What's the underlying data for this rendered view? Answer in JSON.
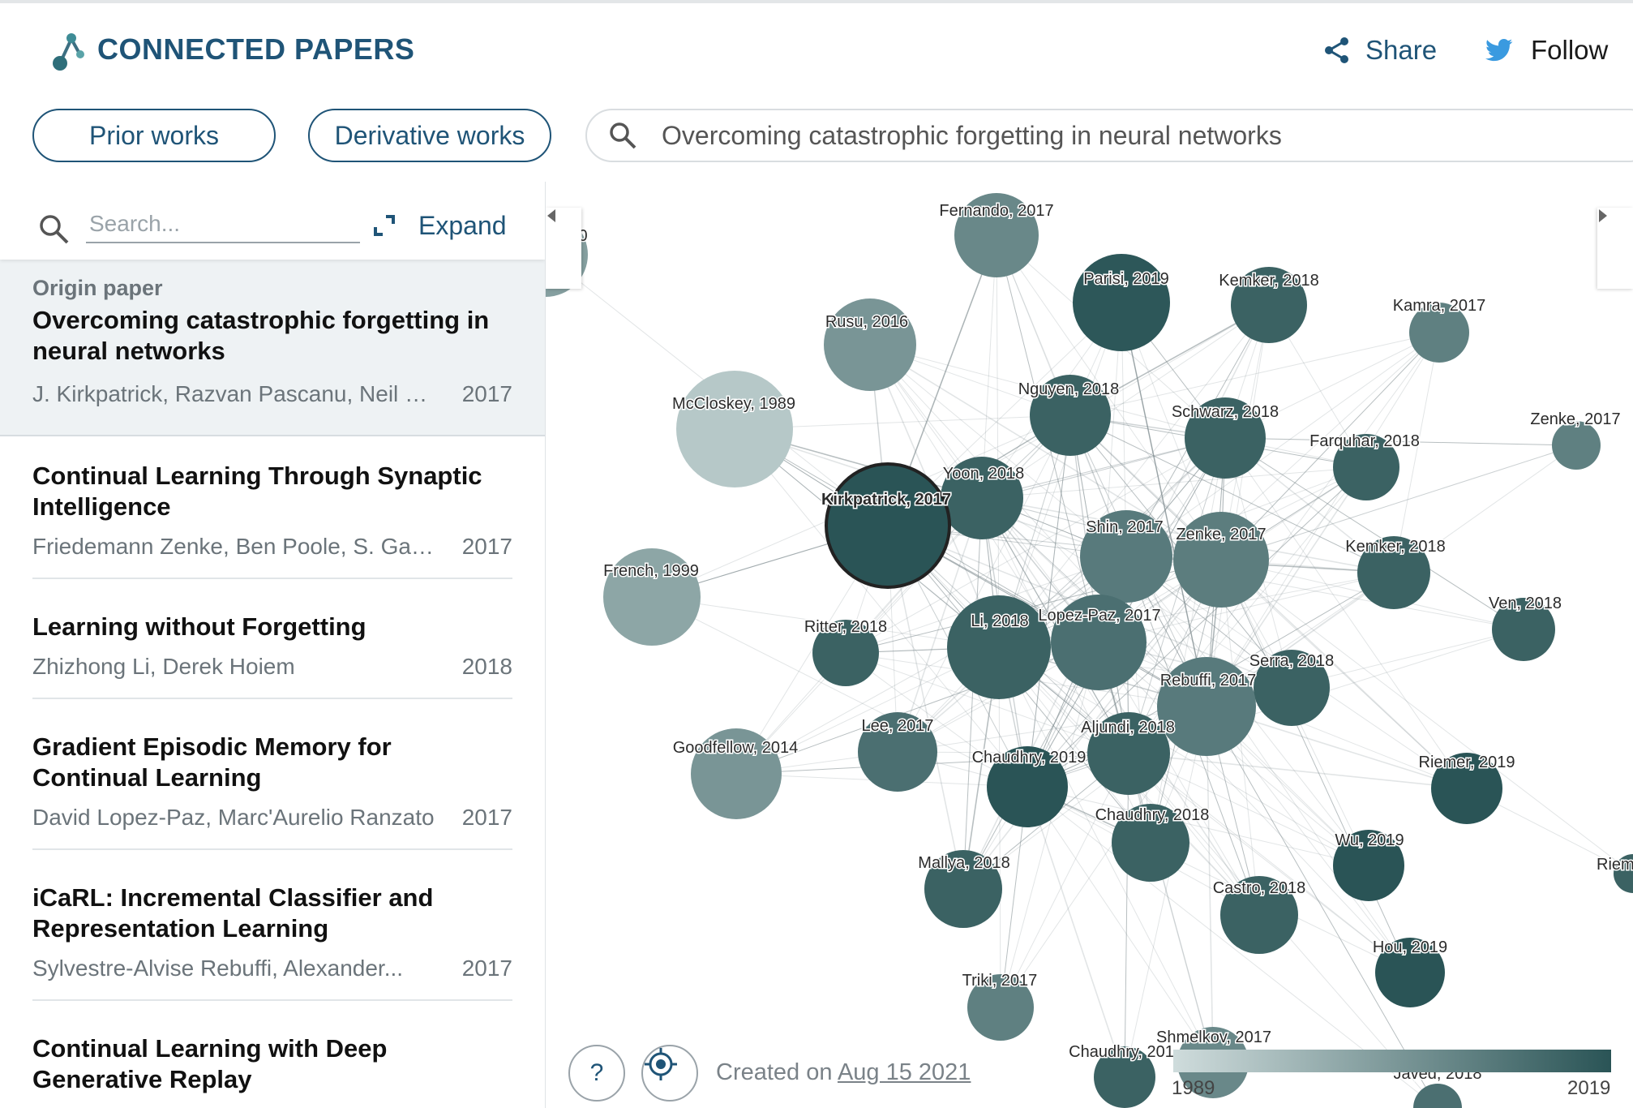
{
  "header": {
    "brand": "CONNECTED PAPERS",
    "share_label": "Share",
    "follow_label": "Follow",
    "accent": "#1f5477"
  },
  "toolbar": {
    "prior_works": "Prior works",
    "derivative_works": "Derivative works",
    "search_value": "Overcoming catastrophic forgetting in neural networks"
  },
  "sidebar": {
    "search_placeholder": "Search...",
    "expand_label": "Expand",
    "origin_label": "Origin paper",
    "origin": {
      "title": "Overcoming catastrophic forgetting in neural networks",
      "authors": "J. Kirkpatrick, Razvan Pascanu, Neil C....",
      "year": "2017"
    },
    "papers": [
      {
        "title": "Continual Learning Through Synaptic Intelligence",
        "authors": "Friedemann Zenke, Ben Poole, S. Ganguli",
        "year": "2017"
      },
      {
        "title": "Learning without Forgetting",
        "authors": "Zhizhong Li, Derek Hoiem",
        "year": "2018"
      },
      {
        "title": "Gradient Episodic Memory for Continual Learning",
        "authors": "David Lopez-Paz, Marc'Aurelio Ranzato",
        "year": "2017"
      },
      {
        "title": "iCaRL: Incremental Classifier and Representation Learning",
        "authors": "Sylvestre-Alvise Rebuffi, Alexander...",
        "year": "2017"
      },
      {
        "title": "Continual Learning with Deep Generative Replay",
        "authors": "",
        "year": ""
      }
    ]
  },
  "graph": {
    "created_prefix": "Created on ",
    "created_date": "Aug 15 2021",
    "help_label": "?",
    "legend_min": "1989",
    "legend_max": "2019",
    "color_old": "#cfdcdc",
    "color_new": "#2a5456",
    "nodes": [
      {
        "label": "Fernando, 2017"
      },
      {
        "label": "Parisi, 2019"
      },
      {
        "label": "Kemker, 2018"
      },
      {
        "label": "Kamra, 2017"
      },
      {
        "label": "Rusu, 2016"
      },
      {
        "label": "McCloskey, 1989"
      },
      {
        "label": "Nguyen, 2018"
      },
      {
        "label": "Schwarz, 2018"
      },
      {
        "label": "Zenke, 2017"
      },
      {
        "label": "Farquhar, 2018"
      },
      {
        "label": "Yoon, 2018"
      },
      {
        "label": "Kirkpatrick, 2017"
      },
      {
        "label": "Shin, 2017"
      },
      {
        "label": "Zenke, 2017"
      },
      {
        "label": "Kemker, 2018"
      },
      {
        "label": "French, 1999"
      },
      {
        "label": "Ritter, 2018"
      },
      {
        "label": "Li, 2018"
      },
      {
        "label": "Lopez-Paz, 2017"
      },
      {
        "label": "Ven, 2018"
      },
      {
        "label": "Serra, 2018"
      },
      {
        "label": "Rebuffi, 2017"
      },
      {
        "label": "Lee, 2017"
      },
      {
        "label": "Aljundi, 2018"
      },
      {
        "label": "Goodfellow, 2014"
      },
      {
        "label": "Chaudhry, 2019"
      },
      {
        "label": "Riemer, 2019"
      },
      {
        "label": "Chaudhry, 2018"
      },
      {
        "label": "Wu, 2019"
      },
      {
        "label": "Mallya, 2018"
      },
      {
        "label": "Castro, 2018"
      },
      {
        "label": "Riem"
      },
      {
        "label": "Hou, 2019"
      },
      {
        "label": "Triki, 2017"
      },
      {
        "label": "Shmelkov, 2017"
      },
      {
        "label": "Chaudhry, 201"
      },
      {
        "label": "Javed, 2018"
      },
      {
        "label": "0"
      }
    ]
  }
}
